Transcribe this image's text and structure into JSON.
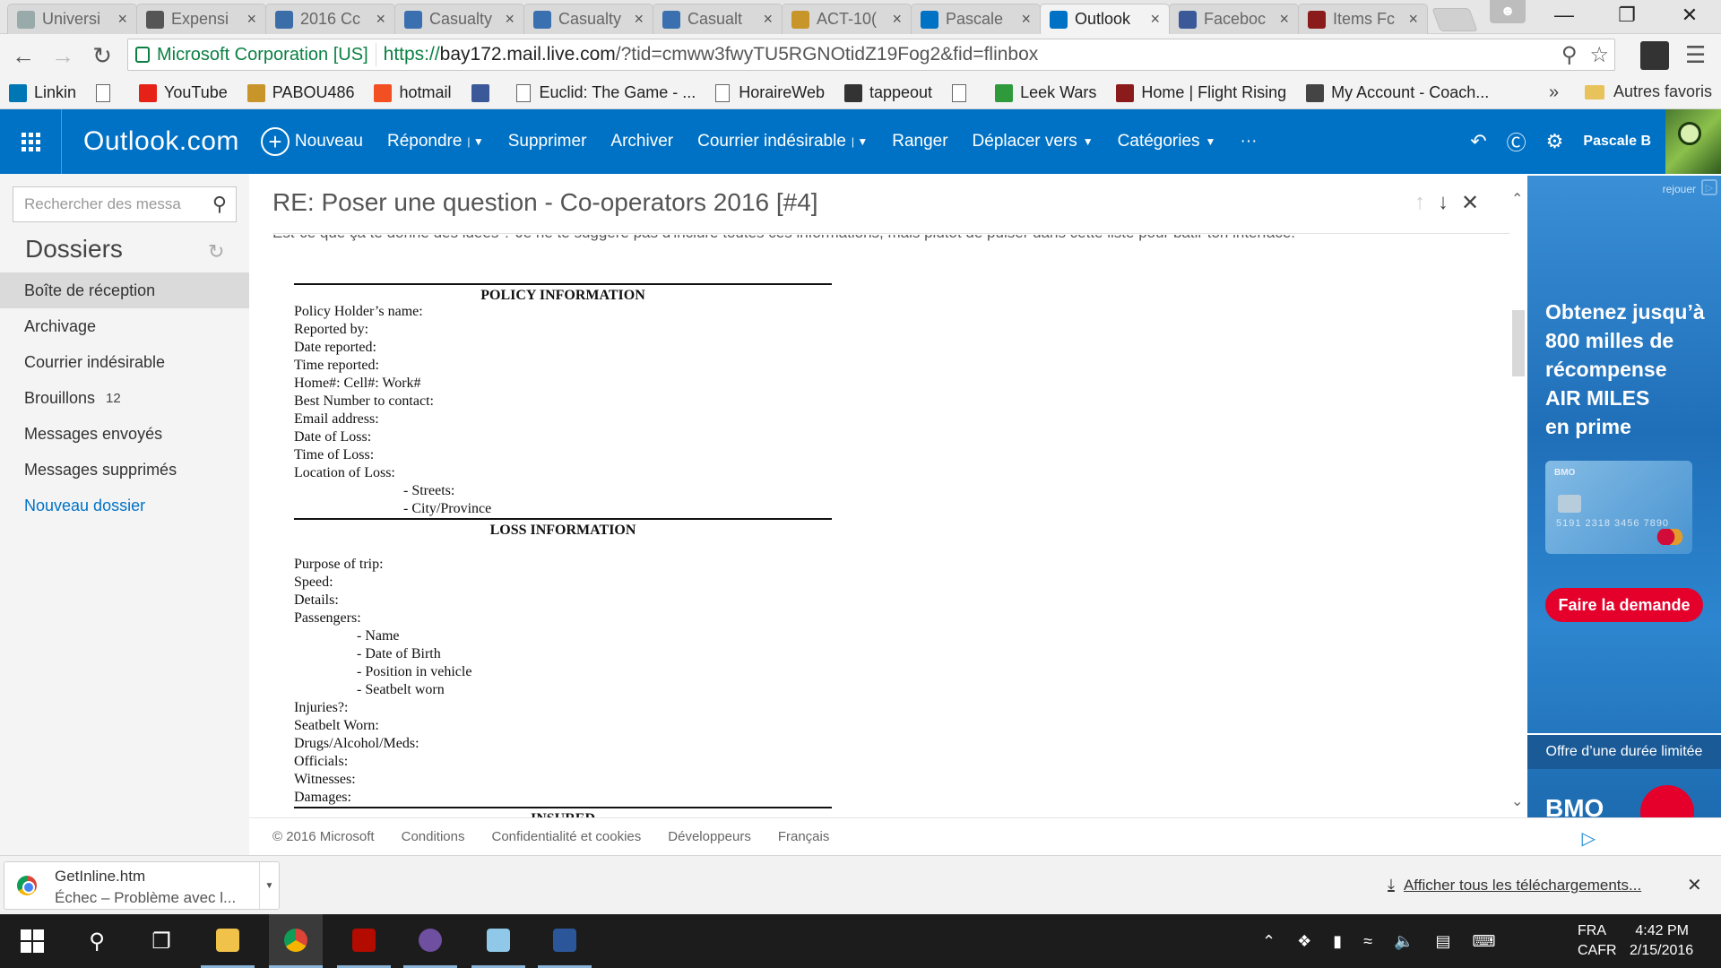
{
  "browser": {
    "tabs": [
      {
        "label": "Universi",
        "icon": "page-icon",
        "active": false
      },
      {
        "label": "Expensi",
        "icon": "expensify-icon",
        "active": false
      },
      {
        "label": "2016 Cc",
        "icon": "shield-icon",
        "active": false
      },
      {
        "label": "Casualty",
        "icon": "cas-icon",
        "active": false
      },
      {
        "label": "Casualty",
        "icon": "cas-icon",
        "active": false
      },
      {
        "label": "Casualt",
        "icon": "cas-icon",
        "active": false
      },
      {
        "label": "ACT-10(",
        "icon": "grid-icon",
        "active": false
      },
      {
        "label": "Pascale",
        "icon": "outlook-icon",
        "active": false
      },
      {
        "label": "Outlook",
        "icon": "outlook-icon",
        "active": true
      },
      {
        "label": "Faceboc",
        "icon": "facebook-icon",
        "active": false
      },
      {
        "label": "Items Fc",
        "icon": "flightrising-icon",
        "active": false
      }
    ],
    "address": {
      "ev_name": "Microsoft Corporation [US]",
      "protocol": "https://",
      "host": "bay172.mail.live.com",
      "path": "/?tid=cmww3fwyTU5RGNOtidZ19Fog2&fid=flinbox"
    },
    "bookmarks": [
      {
        "label": "Linkin",
        "icon": "linkedin-icon"
      },
      {
        "label": "",
        "icon": "page-icon"
      },
      {
        "label": "YouTube",
        "icon": "youtube-icon"
      },
      {
        "label": "PABOU486",
        "icon": "grid-icon"
      },
      {
        "label": "hotmail",
        "icon": "windows-icon"
      },
      {
        "label": "",
        "icon": "facebook-icon"
      },
      {
        "label": "Euclid: The Game - ...",
        "icon": "page-icon"
      },
      {
        "label": "HoraireWeb",
        "icon": "page-icon"
      },
      {
        "label": "tappeout",
        "icon": "tappeout-icon"
      },
      {
        "label": "",
        "icon": "page-icon"
      },
      {
        "label": "Leek Wars",
        "icon": "leek-icon"
      },
      {
        "label": "Home | Flight Rising",
        "icon": "flightrising-icon"
      },
      {
        "label": "My Account - Coach...",
        "icon": "coach-icon"
      }
    ],
    "bookmarks_more": "»",
    "other_bookmarks": "Autres favoris"
  },
  "outlook": {
    "brand": "Outlook.com",
    "commands": {
      "new": "Nouveau",
      "reply": "Répondre",
      "delete": "Supprimer",
      "archive": "Archiver",
      "junk": "Courrier indésirable",
      "sweep": "Ranger",
      "move": "Déplacer vers",
      "categories": "Catégories",
      "more": "···"
    },
    "user": "Pascale B",
    "search_placeholder": "Rechercher des messa",
    "folders_title": "Dossiers",
    "folders": [
      {
        "label": "Boîte de réception",
        "count": "",
        "selected": true
      },
      {
        "label": "Archivage",
        "count": ""
      },
      {
        "label": "Courrier indésirable",
        "count": ""
      },
      {
        "label": "Brouillons",
        "count": "12"
      },
      {
        "label": "Messages envoyés",
        "count": ""
      },
      {
        "label": "Messages supprimés",
        "count": ""
      }
    ],
    "new_folder": "Nouveau dossier"
  },
  "message": {
    "subject": "RE: Poser une question - Co-operators 2016 [#4]",
    "clipped_line": "Est-ce que ça te donne des idées ? Je ne te suggère pas d'inclure toutes ces informations, mais plutôt de puiser dans cette liste pour bâtir ton interface.",
    "sections": {
      "policy": "POLICY INFORMATION",
      "loss": "LOSS INFORMATION",
      "insured": "INSURED"
    },
    "policy_lines": [
      "Policy Holder’s name:",
      "Reported by:",
      "Date reported:",
      "Time reported:",
      "Home#: Cell#: Work#",
      "Best Number to contact:",
      "Email address:",
      "Date of Loss:",
      "Time of Loss:",
      "Location of Loss:"
    ],
    "location_sub": [
      "- Streets:",
      "- City/Province"
    ],
    "loss_lines_a": [
      "Purpose of trip:",
      "Speed:",
      "Details:",
      "Passengers:"
    ],
    "passenger_sub": [
      "- Name",
      "- Date of Birth",
      "- Position in vehicle",
      "- Seatbelt worn"
    ],
    "loss_lines_b": [
      "Injuries?:",
      "Seatbelt Worn:",
      "Drugs/Alcohol/Meds:",
      "Officials:",
      "Witnesses:",
      "Damages:"
    ]
  },
  "ad": {
    "replay": "rejouer",
    "headline_lines": [
      "Obtenez jusqu’à",
      "800 milles de",
      "récompense",
      "AIR MILES",
      "en prime"
    ],
    "card_brand": "BMO",
    "card_number": "5191 2318 3456 7890",
    "cta": "Faire la demande",
    "band": "Offre d’une durée limitée",
    "logo": "BMO"
  },
  "footer": {
    "copyright": "© 2016 Microsoft",
    "links": [
      "Conditions",
      "Confidentialité et cookies",
      "Développeurs",
      "Français"
    ]
  },
  "downloads": {
    "file": "GetInline.htm",
    "status": "Échec – Problème avec l...",
    "show_all": "Afficher tous les téléchargements..."
  },
  "taskbar": {
    "lang_line1": "FRA",
    "lang_line2": "CAFR",
    "time": "4:42 PM",
    "date": "2/15/2016"
  },
  "colors": {
    "outlook_blue": "#0072c6",
    "ev_green": "#0b8043",
    "ad_red": "#e4002b"
  }
}
